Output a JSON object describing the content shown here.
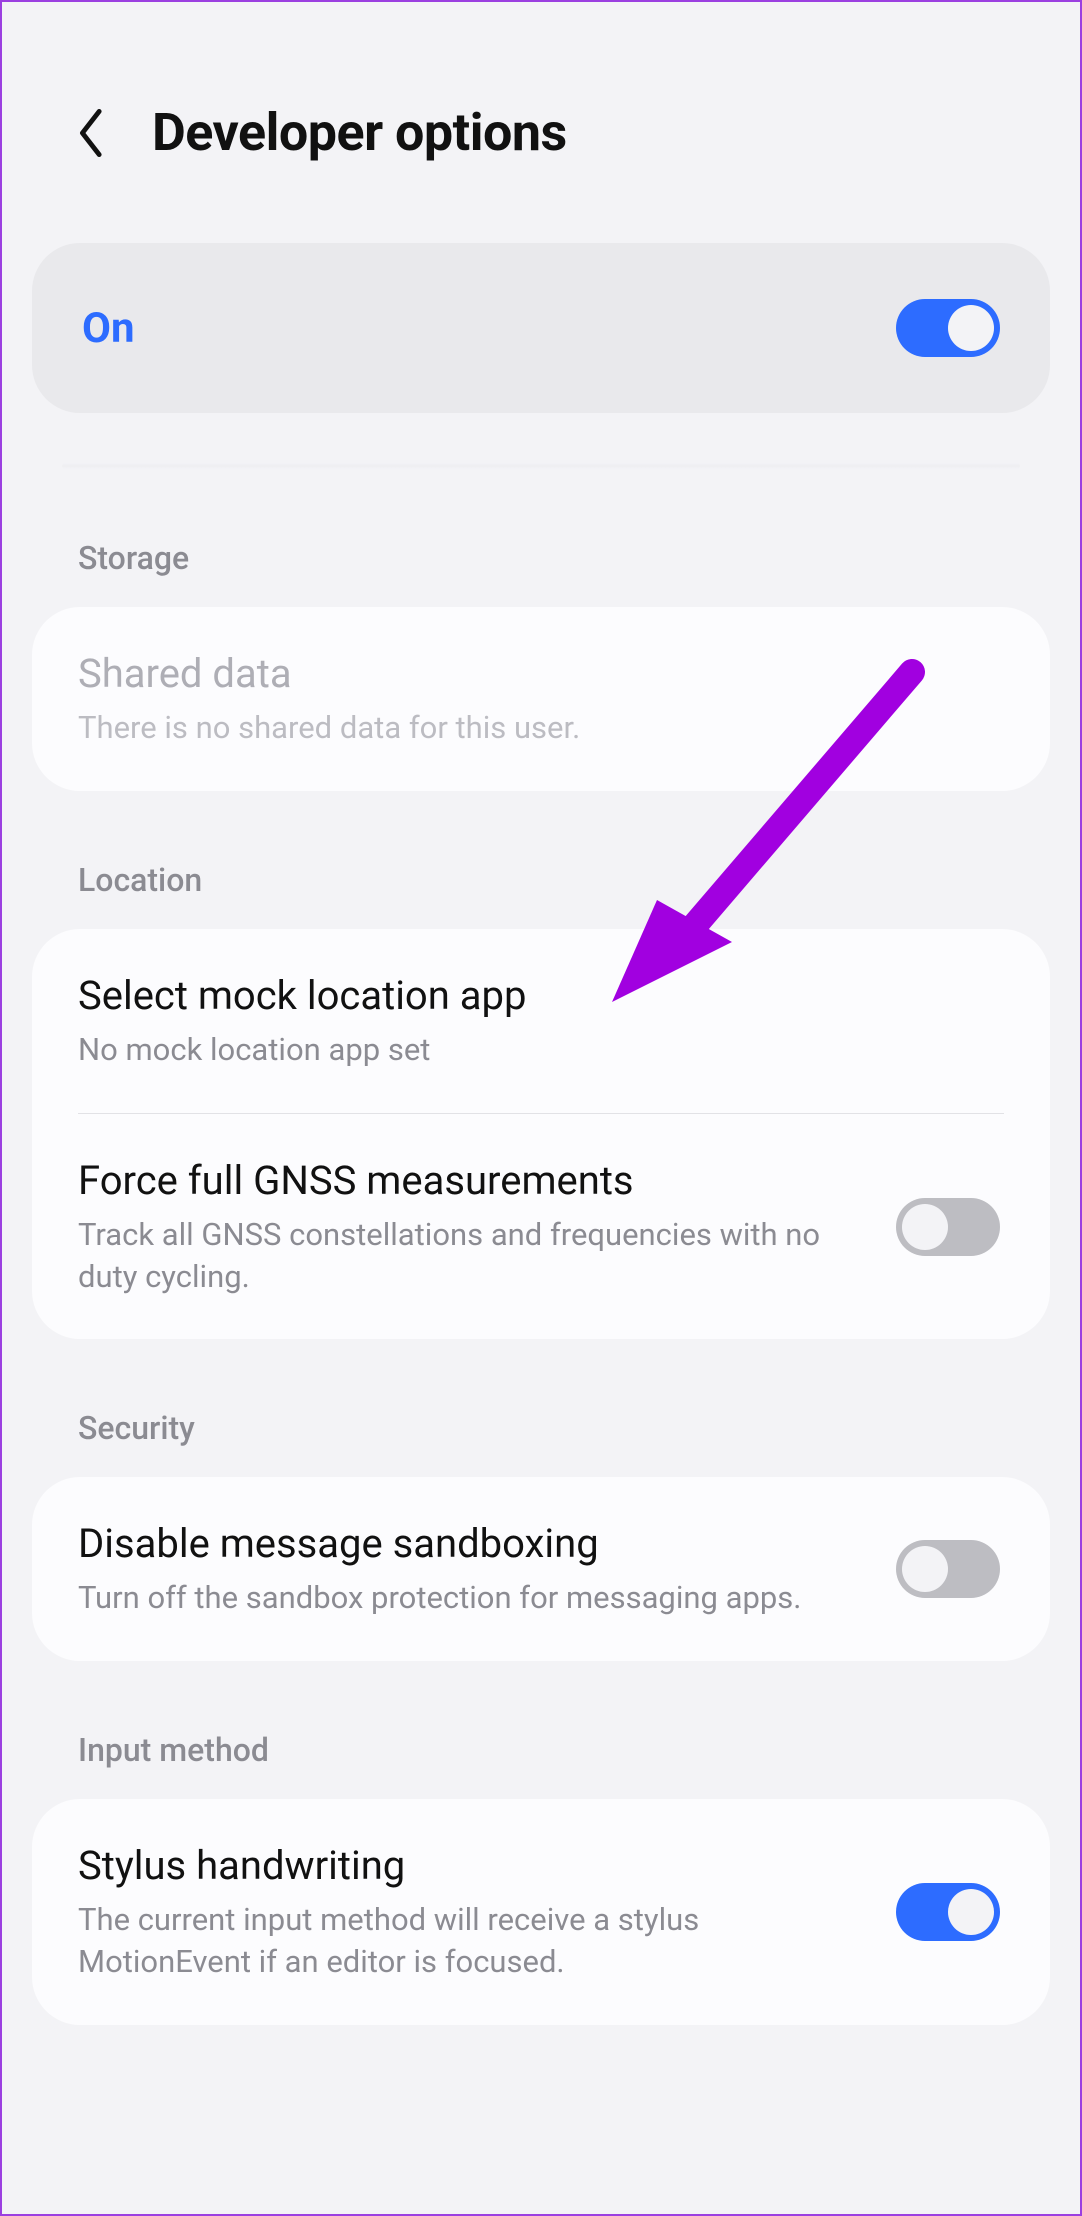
{
  "header": {
    "title": "Developer options"
  },
  "master": {
    "label": "On",
    "on": true
  },
  "sections": {
    "storage": {
      "header": "Storage",
      "shared_data": {
        "title": "Shared data",
        "sub": "There is no shared data for this user."
      }
    },
    "location": {
      "header": "Location",
      "mock": {
        "title": "Select mock location app",
        "sub": "No mock location app set"
      },
      "gnss": {
        "title": "Force full GNSS measurements",
        "sub": "Track all GNSS constellations and frequencies with no duty cycling.",
        "on": false
      }
    },
    "security": {
      "header": "Security",
      "sandbox": {
        "title": "Disable message sandboxing",
        "sub": "Turn off the sandbox protection for messaging apps.",
        "on": false
      }
    },
    "input": {
      "header": "Input method",
      "stylus": {
        "title": "Stylus handwriting",
        "sub": "The current input method will receive a stylus MotionEvent if an editor is focused.",
        "on": true
      }
    }
  },
  "annotation": {
    "color": "#a100e0"
  }
}
